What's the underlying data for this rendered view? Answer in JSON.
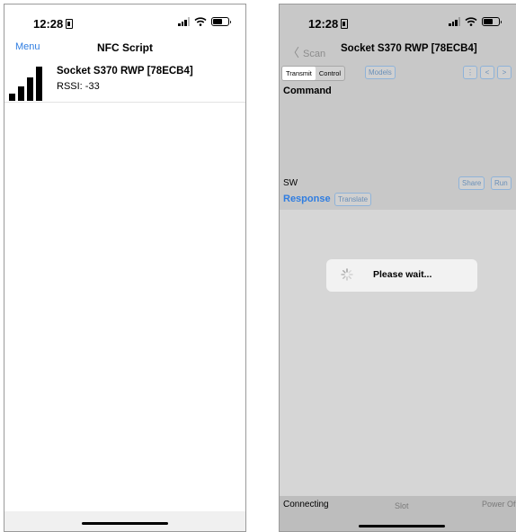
{
  "left_screen": {
    "status": {
      "time": "12:28"
    },
    "nav": {
      "menu_label": "Menu",
      "title": "NFC Script"
    },
    "device": {
      "name": "Socket S370 RWP [78ECB4]",
      "rssi": "RSSI: -33"
    }
  },
  "right_screen": {
    "status": {
      "time": "12:28"
    },
    "nav": {
      "back_label": "Scan",
      "title": "Socket S370 RWP [78ECB4]"
    },
    "toolbar": {
      "tabs": [
        {
          "label": "Transmit"
        },
        {
          "label": "Control"
        }
      ],
      "models_label": "Models",
      "menu_glyph": "⋮",
      "prev_glyph": "<",
      "next_glyph": ">"
    },
    "command_label": "Command",
    "sw_label": "SW",
    "share_label": "Share",
    "run_label": "Run",
    "response_label": "Response",
    "translate_label": "Translate",
    "dialog": {
      "message": "Please wait..."
    },
    "statusbar": {
      "connection": "Connecting",
      "slot": "Slot",
      "power": "Power Of"
    }
  },
  "colors": {
    "accent": "#2f7de1",
    "overlay_gray": "#c8c8c8",
    "dialog_bg": "#f2f2f2"
  }
}
